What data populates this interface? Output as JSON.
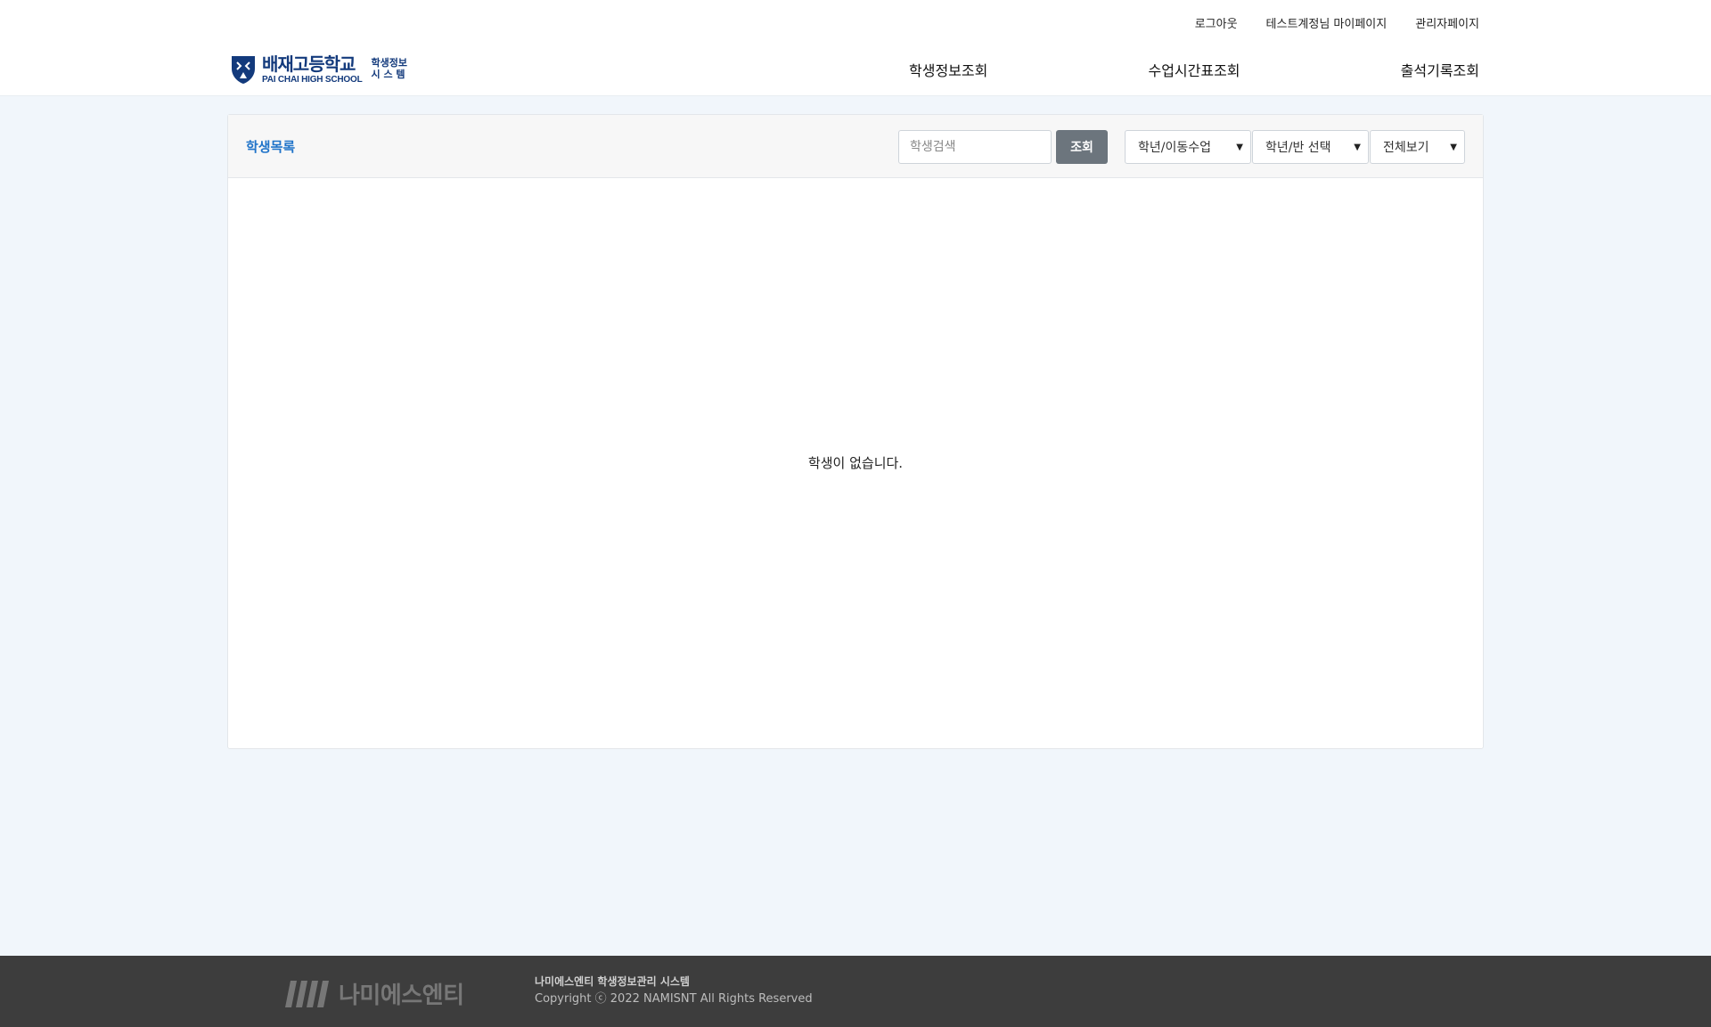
{
  "util_nav": {
    "logout": "로그아웃",
    "mypage": "테스트계정님 마이페이지",
    "admin": "관리자페이지"
  },
  "logo": {
    "name_ko": "배재고등학교",
    "name_en": "PAI CHAI HIGH SCHOOL",
    "sub_line1": "학생정보",
    "sub_line2": "시 스 템",
    "icon": "shield-icon"
  },
  "main_nav": {
    "students": "학생정보조회",
    "timetable": "수업시간표조회",
    "attendance": "출석기록조회"
  },
  "panel": {
    "title": "학생목록",
    "search_placeholder": "학생검색",
    "search_button": "조회",
    "filter_grade_class": "학년/이동수업",
    "filter_class_select": "학년/반 선택",
    "filter_view": "전체보기",
    "empty_message": "학생이 없습니다."
  },
  "footer": {
    "company_logo_name": "나미에스엔티",
    "system_name": "나미에스엔티 학생정보관리 시스템",
    "copyright": "Copyright ⓒ 2022 NAMISNT All Rights Reserved"
  },
  "colors": {
    "accent": "#1f73c9",
    "brand_navy": "#133a7c",
    "footer_bg": "#3d3d3d",
    "page_bg": "#f1f6fb"
  }
}
